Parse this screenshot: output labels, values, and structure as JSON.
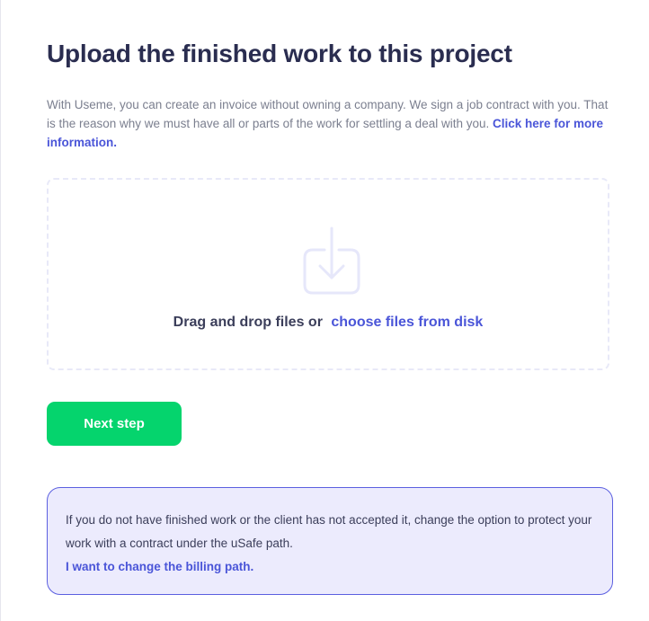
{
  "header": {
    "title": "Upload the finished work to this project"
  },
  "intro": {
    "text": "With Useme, you can create an invoice without owning a company. We sign a job contract with you. That is the reason why we must have all or parts of the work for settling a deal with you.",
    "link_label": "Click here for more information."
  },
  "dropzone": {
    "icon": "download-tray-icon",
    "prompt": "Drag and drop files or",
    "choose_label": "choose files from disk"
  },
  "actions": {
    "next_label": "Next step"
  },
  "info_box": {
    "text": "If you do not have finished work or the client has not accepted it, change the option to protect your work with a contract under the uSafe path.",
    "link_label": "I want to change the billing path."
  },
  "colors": {
    "accent": "#4a55d8",
    "primary_button": "#05d46d",
    "title": "#2a2d50",
    "info_background": "#ecebfd",
    "info_border": "#5b5fe0"
  }
}
